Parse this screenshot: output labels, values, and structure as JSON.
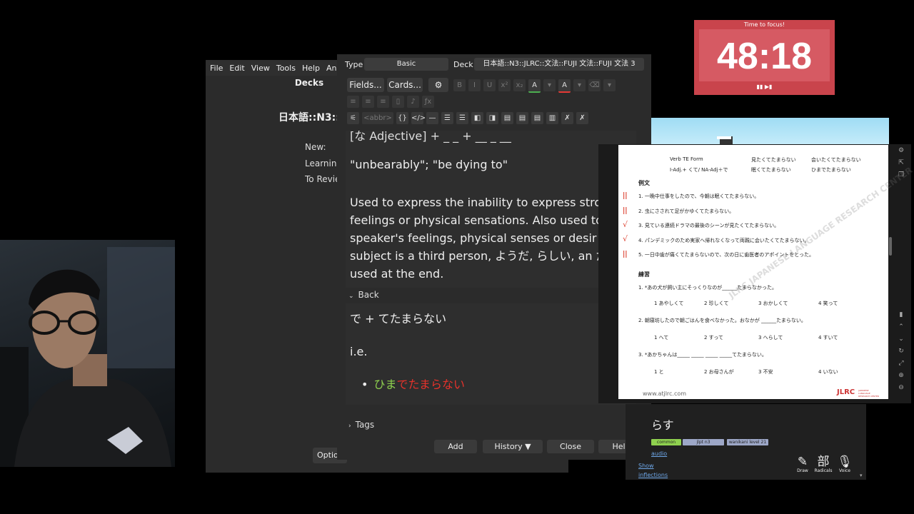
{
  "anki": {
    "menu": [
      "File",
      "Edit",
      "View",
      "Tools",
      "Help",
      "Anki"
    ],
    "decks_tab": "Decks",
    "deck_title": "日本語::N3::",
    "stats": [
      "New:",
      "Learning",
      "To Revie"
    ],
    "options": "Optio"
  },
  "editor": {
    "type_label": "Type",
    "type_value": "Basic",
    "deck_label": "Deck",
    "deck_value": "日本語::N3::JLRC::文法::FUJI 文法::FUJI 文法 3",
    "fields_btn": "Fields...",
    "cards_btn": "Cards...",
    "toolbar_row1": [
      "B",
      "I",
      "U",
      "x²",
      "x₂",
      "A",
      "▾",
      "A",
      "▾",
      "⌫",
      "▾"
    ],
    "toolbar_row2": [
      "≡",
      "≡",
      "≡",
      "▯",
      "♪",
      "ƒx"
    ],
    "toolbar_row3": [
      "⚟",
      "<abbr>",
      "{}",
      "</>",
      "—",
      "☰",
      "☰",
      "◧",
      "◨",
      "▤",
      "▤",
      "▤",
      "▥",
      "✗",
      "✗"
    ],
    "front_cut": "[な Adjective] + _ _ + __ _ __",
    "front_def": "\"unbearably\"; \"be dying to\"",
    "front_expl": "Used to express the inability to express strong feelings or physical sensations. Also used to de the speaker's feelings, physical senses or desir the subject is a third person, ようだ, らしい, an だ are used at the end.",
    "back_label": "Back",
    "back_formula": "で + てたまらない",
    "back_ie": "i.e.",
    "back_example_green": "ひま",
    "back_example_red": "でたまらない",
    "tags_label": "Tags",
    "buttons": {
      "add": "Add",
      "history": "History ▼",
      "close": "Close",
      "help": "Help"
    }
  },
  "timer": {
    "label": "Time to focus!",
    "time": "48:18",
    "controls": "▮▮ ▶▮"
  },
  "worksheet": {
    "header_left1": "Verb TE Form",
    "header_left2": "I-Adj.+ くて/ NA-Adj＋で",
    "header_mid1": "見たくてたまらない",
    "header_mid2": "眠くてたまらない",
    "header_right1": "会いたくてたまらない",
    "header_right2": "ひまでたまらない",
    "examples_title": "例文",
    "examples": [
      "1. 一晩中仕事をしたので、今朝は眠くてたまらない。",
      "2. 虫にさされて足がかゆくてたまらない。",
      "3. 見ている連続ドラマの最後のシーンが見たくてたまらない。",
      "4. パンデミックのため実家へ帰れなくなって両親に会いたくてたまらない。",
      "5. 一日中歯が痛くてたまらないので、次の日に歯医者のアポイントをとった。"
    ],
    "exercise_title": "練習",
    "q1": "1. *あの犬が飼い主にそっくりなのが______たまらなかった。",
    "q1_opts": [
      "1 あやしくて",
      "2 珍しくて",
      "3 おかしくて",
      "4 笑って"
    ],
    "q2": "2. 朝寝坊したので朝ごはんを食べなかった。おなかが ______たまらない。",
    "q2_opts": [
      "1 へて",
      "2 すって",
      "3 へらして",
      "4 すいて"
    ],
    "q3": "3. *あかちゃんは_____ _____ _____ _____てたまらない。",
    "q3_opts": [
      "1 と",
      "2 お母さんが",
      "3 不安",
      "4 いない"
    ],
    "footer_url": "www.atjlrc.com",
    "footer_logo": "JLRC",
    "footer_logo_sub": "JAPANESE LANGUAGE RESEARCH CENTER",
    "watermark": "JLRC JAPANESE LANGUAGE RESEARCH CENTER"
  },
  "dict": {
    "word": "らす",
    "chips": [
      "common word",
      "jlpt n3",
      "wanikani level 21"
    ],
    "audio": "audio",
    "show": "Show",
    "inflections": "inflections",
    "tools": [
      {
        "icon": "✎",
        "label": "Draw"
      },
      {
        "icon": "部",
        "label": "Radicals"
      },
      {
        "icon": "🎙",
        "label": "Voice"
      }
    ]
  },
  "colors": {
    "timer_bg": "#c9444c",
    "green_text": "#8fd14f",
    "red_text": "#e5322b",
    "link": "#6ea7e8"
  }
}
